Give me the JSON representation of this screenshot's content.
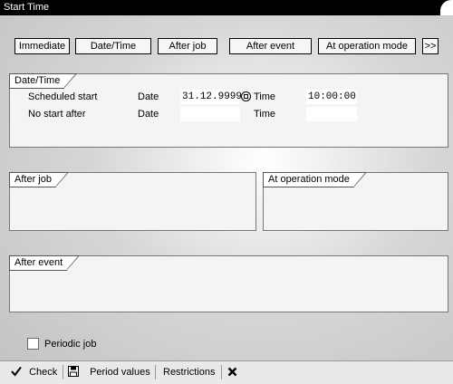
{
  "window": {
    "title": "Start Time"
  },
  "buttons": {
    "immediate": "Immediate",
    "date_time": "Date/Time",
    "after_job": "After job",
    "after_event": "After event",
    "at_operation_mode": "At operation mode",
    "more": ">>"
  },
  "datetime_group": {
    "title": "Date/Time",
    "scheduled_start_label": "Scheduled start",
    "no_start_after_label": "No start after",
    "date_label": "Date",
    "time_label": "Time",
    "scheduled_date": "31.12.9999",
    "scheduled_time": "10:00:00",
    "no_start_date": "",
    "no_start_time": ""
  },
  "after_job_group": {
    "title": "After job"
  },
  "operation_mode_group": {
    "title": "At operation mode"
  },
  "after_event_group": {
    "title": "After event"
  },
  "periodic_job": {
    "label": "Periodic job",
    "checked": false
  },
  "toolbar": {
    "check": "Check",
    "period_values": "Period values",
    "restrictions": "Restrictions"
  }
}
